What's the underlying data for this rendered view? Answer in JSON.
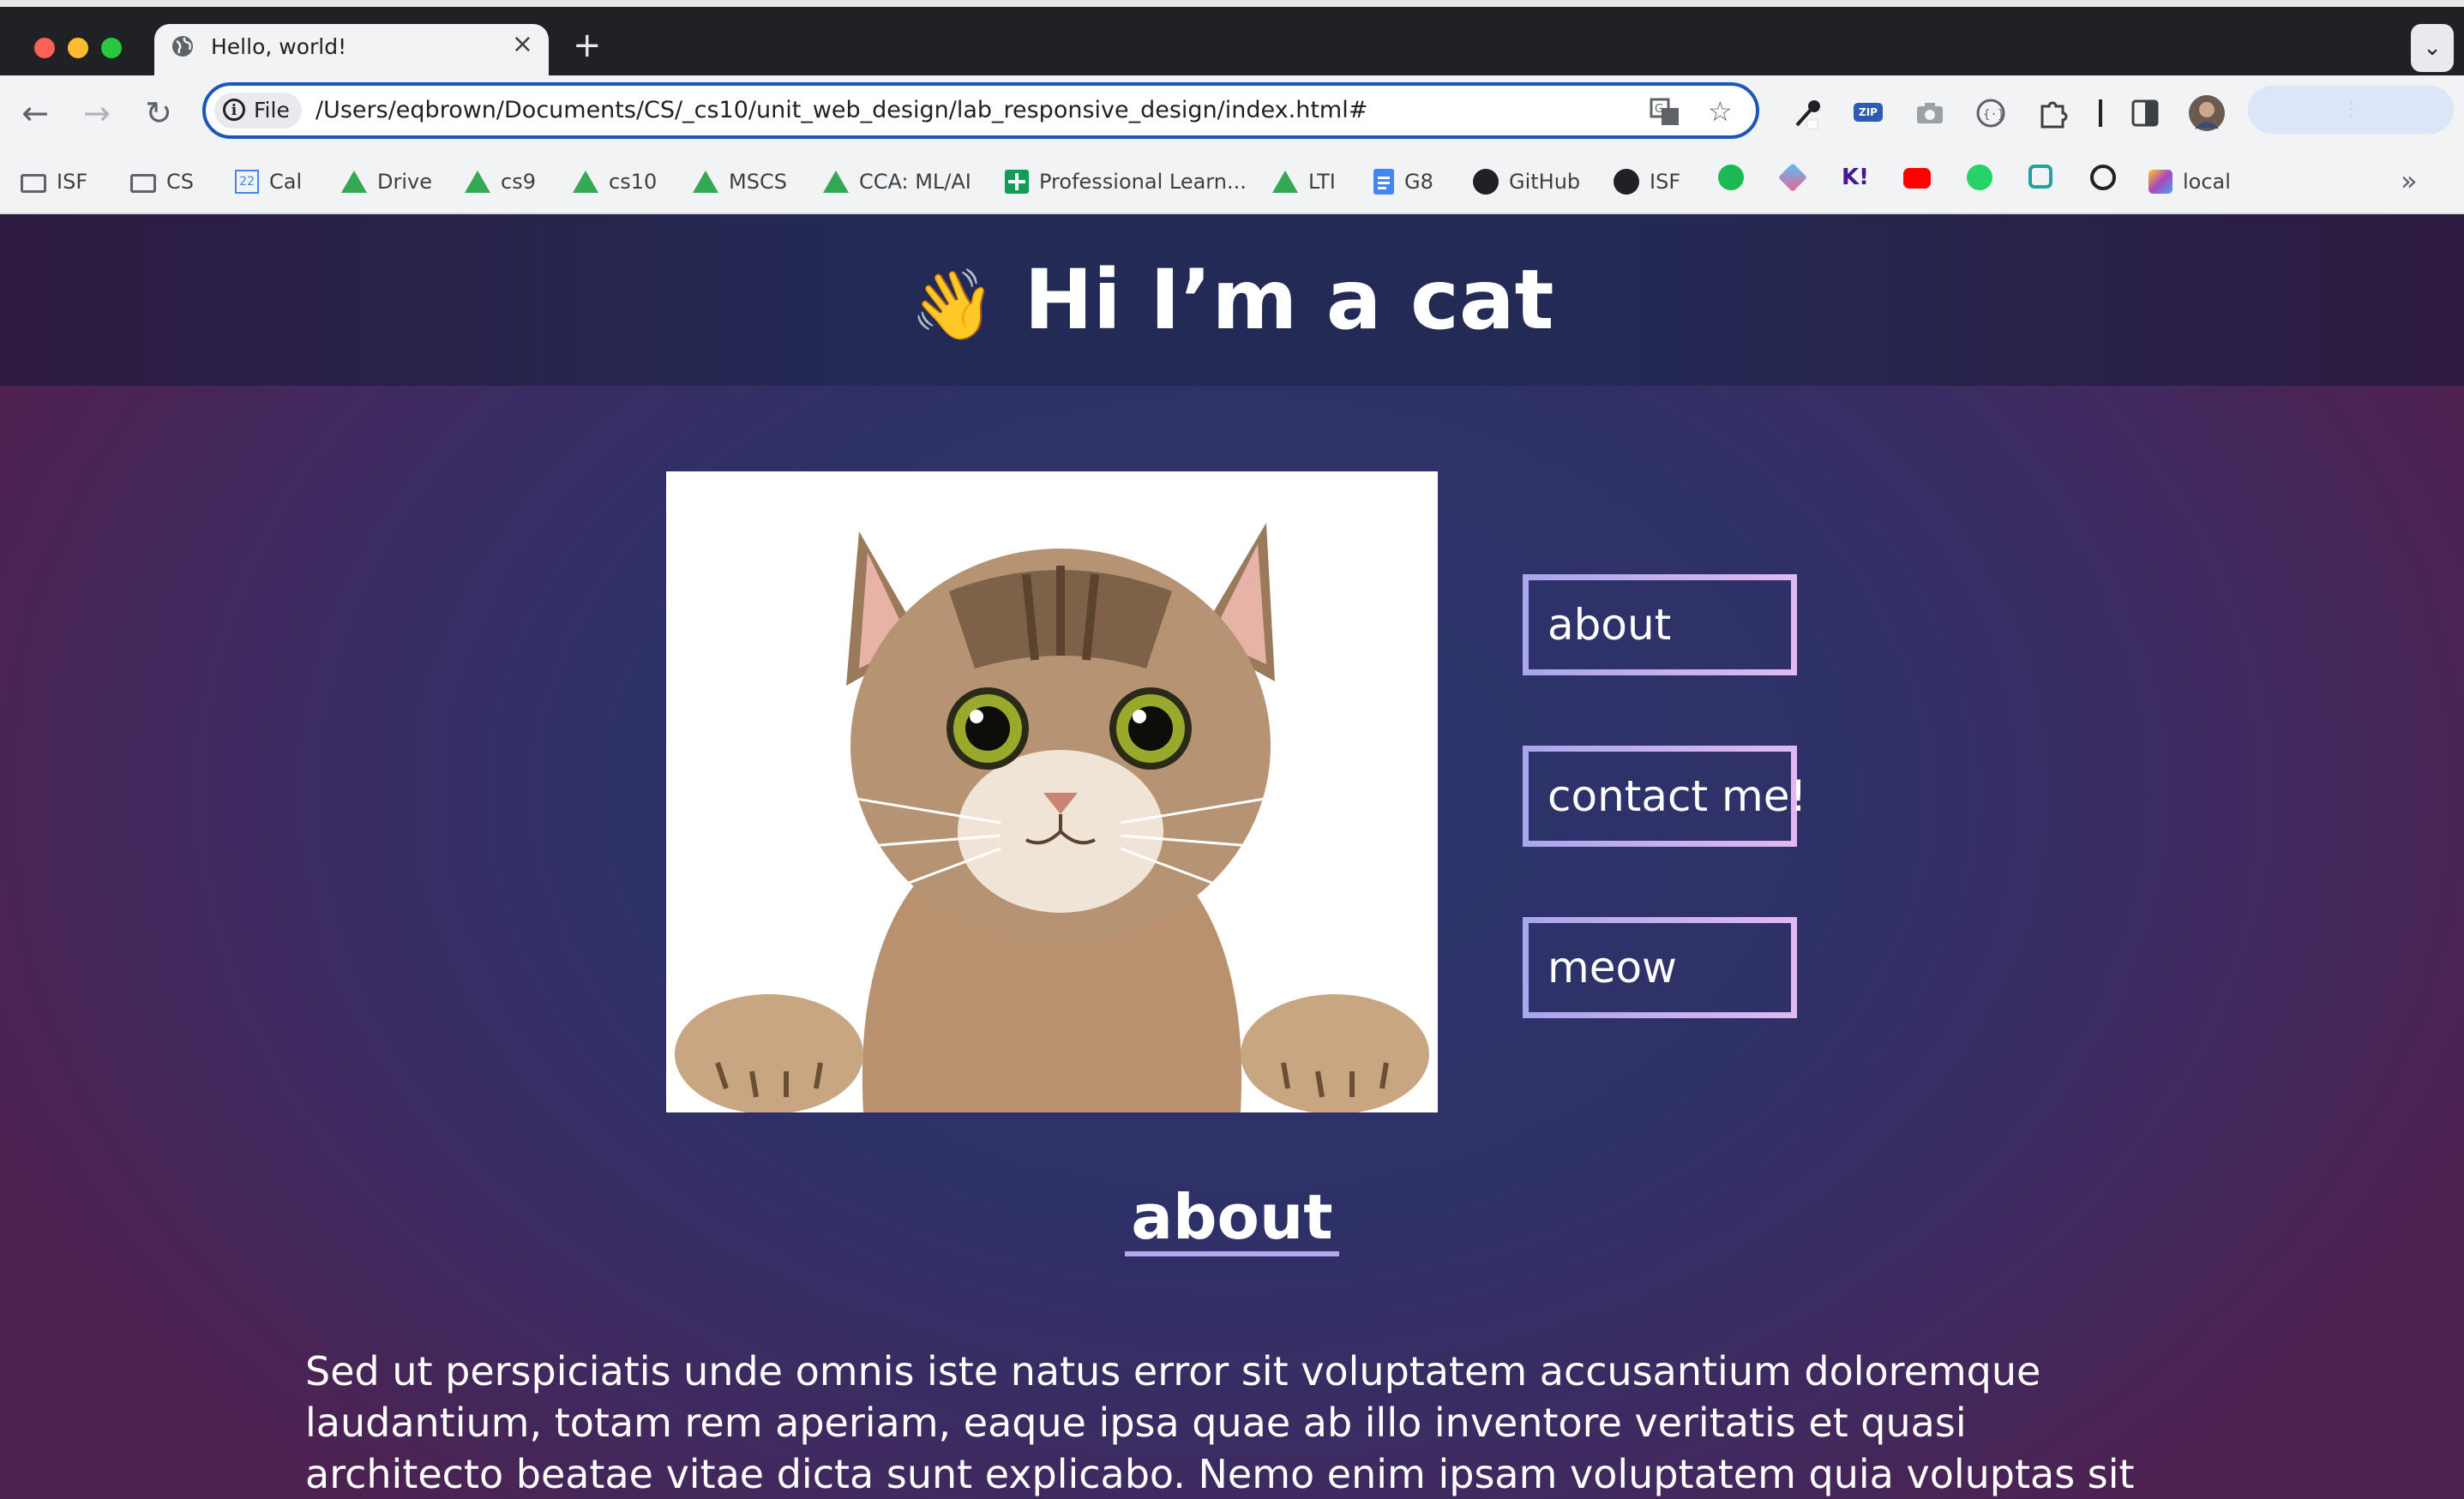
{
  "browser": {
    "tab": {
      "title": "Hello, world!",
      "close": "×"
    },
    "new_tab": "+",
    "tab_search": "⌄",
    "url_chip": "File",
    "url": "/Users/eqbrown/Documents/CS/_cs10/unit_web_design/lab_responsive_design/index.html#",
    "bookmarks": [
      {
        "label": "ISF",
        "icon": "folder-icon"
      },
      {
        "label": "CS",
        "icon": "folder-icon"
      },
      {
        "label": "Cal",
        "icon": "calendar-icon"
      },
      {
        "label": "Drive",
        "icon": "drive-icon"
      },
      {
        "label": "cs9",
        "icon": "drive-icon"
      },
      {
        "label": "cs10",
        "icon": "drive-icon"
      },
      {
        "label": "MSCS",
        "icon": "drive-icon"
      },
      {
        "label": "CCA: ML/AI",
        "icon": "drive-icon"
      },
      {
        "label": "Professional Learn...",
        "icon": "sheets-icon"
      },
      {
        "label": "LTI",
        "icon": "drive-icon"
      },
      {
        "label": "G8",
        "icon": "docs-icon"
      },
      {
        "label": "GitHub",
        "icon": "github-icon"
      },
      {
        "label": "ISF",
        "icon": "github-icon"
      },
      {
        "label": "local",
        "icon": "cube-icon"
      }
    ],
    "calendar_icon_text": "22",
    "kahoot_text": "K!",
    "overflow": "»"
  },
  "page": {
    "emoji": "👋",
    "title": "Hi I’m a cat",
    "nav": [
      "about",
      "contact me!",
      "meow"
    ],
    "about_heading": "about",
    "about_text": "Sed ut perspiciatis unde omnis iste natus error sit voluptatem accusantium doloremque laudantium, totam rem aperiam, eaque ipsa quae ab illo inventore veritatis et quasi architecto beatae vitae dicta sunt explicabo. Nemo enim ipsam voluptatem quia voluptas sit aspernatur aut"
  },
  "colors": {
    "accent": "#1a57b8",
    "button_border_start": "#a9a6ec",
    "button_border_end": "#e0b8f2",
    "underline": "#b6a8ee"
  }
}
